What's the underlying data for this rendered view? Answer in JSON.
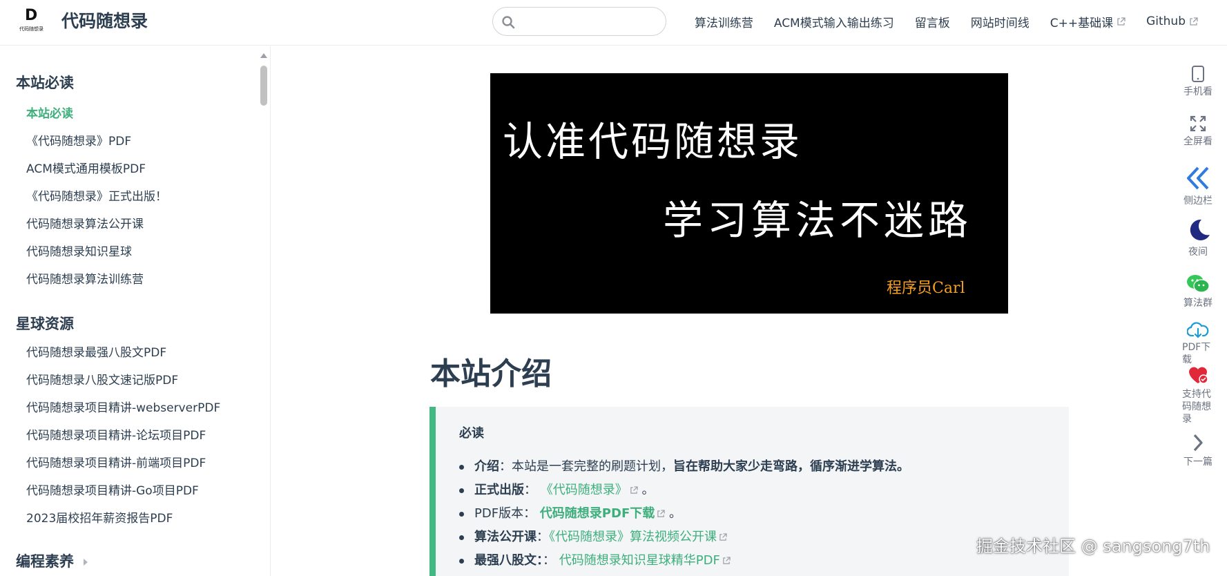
{
  "colors": {
    "accent": "#3eaf7c",
    "tip_border": "#42b983",
    "text": "#2c3e50",
    "tip_bg": "#f3f5f7",
    "banner_sign": "#f5a020"
  },
  "navbar": {
    "logo_letter": "D",
    "logo_caption": "代码随想录",
    "site_title": "代码随想录",
    "search": {
      "value": "",
      "placeholder": ""
    },
    "links": [
      {
        "label": "算法训练营",
        "external": false
      },
      {
        "label": "ACM模式输入输出练习",
        "external": false
      },
      {
        "label": "留言板",
        "external": false
      },
      {
        "label": "网站时间线",
        "external": false
      },
      {
        "label": "C++基础课",
        "external": true
      },
      {
        "label": "Github",
        "external": true
      }
    ]
  },
  "sidebar": {
    "sections": [
      {
        "title": "本站必读",
        "items": [
          "本站必读",
          "《代码随想录》PDF",
          "ACM模式通用模板PDF",
          "《代码随想录》正式出版！",
          "代码随想录算法公开课",
          "代码随想录知识星球",
          "代码随想录算法训练营"
        ]
      },
      {
        "title": "星球资源",
        "items": [
          "代码随想录最强八股文PDF",
          "代码随想录八股文速记版PDF",
          "代码随想录项目精讲-webserverPDF",
          "代码随想录项目精讲-论坛项目PDF",
          "代码随想录项目精讲-前端项目PDF",
          "代码随想录项目精讲-Go项目PDF",
          "2023届校招年薪资报告PDF"
        ]
      },
      {
        "title": "编程素养",
        "items": []
      }
    ],
    "active_item": "本站必读"
  },
  "banner": {
    "line1": "认准代码随想录",
    "line2": "学习算法不迷路",
    "signature": "程序员Carl"
  },
  "main": {
    "title": "本站介绍",
    "tip": {
      "title": "必读",
      "items": [
        {
          "label": "介绍",
          "sep": "：",
          "text": "本站是一套完整的刷题计划，",
          "bold_text": "旨在帮助大家少走弯路，循序渐进学算法。"
        },
        {
          "label": "正式出版",
          "sep": "：",
          "link": "《代码随想录》",
          "tail": "。"
        },
        {
          "label": "PDF版本",
          "sep": "：",
          "link": "代码随想录PDF下载",
          "tail": "。"
        },
        {
          "label": "算法公开课",
          "sep": "：",
          "link": "《代码随想录》算法视频公开课"
        },
        {
          "label": "最强八股文：",
          "sep": "：",
          "link": "代码随想录知识星球精华PDF"
        }
      ]
    }
  },
  "right_toolbar": [
    {
      "icon": "tablet-icon",
      "label": "手机看"
    },
    {
      "icon": "fullscreen-icon",
      "label": "全屏看"
    },
    {
      "icon": "double-chevron-left-icon",
      "label": "侧边栏"
    },
    {
      "icon": "moon-icon",
      "label": "夜间"
    },
    {
      "icon": "wechat-icon",
      "label": "算法群"
    },
    {
      "icon": "cloud-download-icon",
      "label": "PDF下载"
    },
    {
      "icon": "heart-icon",
      "label": "支持代码随想录"
    },
    {
      "icon": "chevron-right-icon",
      "label": "下一篇"
    }
  ],
  "watermark": "掘金技术社区 @ sangsong7th"
}
